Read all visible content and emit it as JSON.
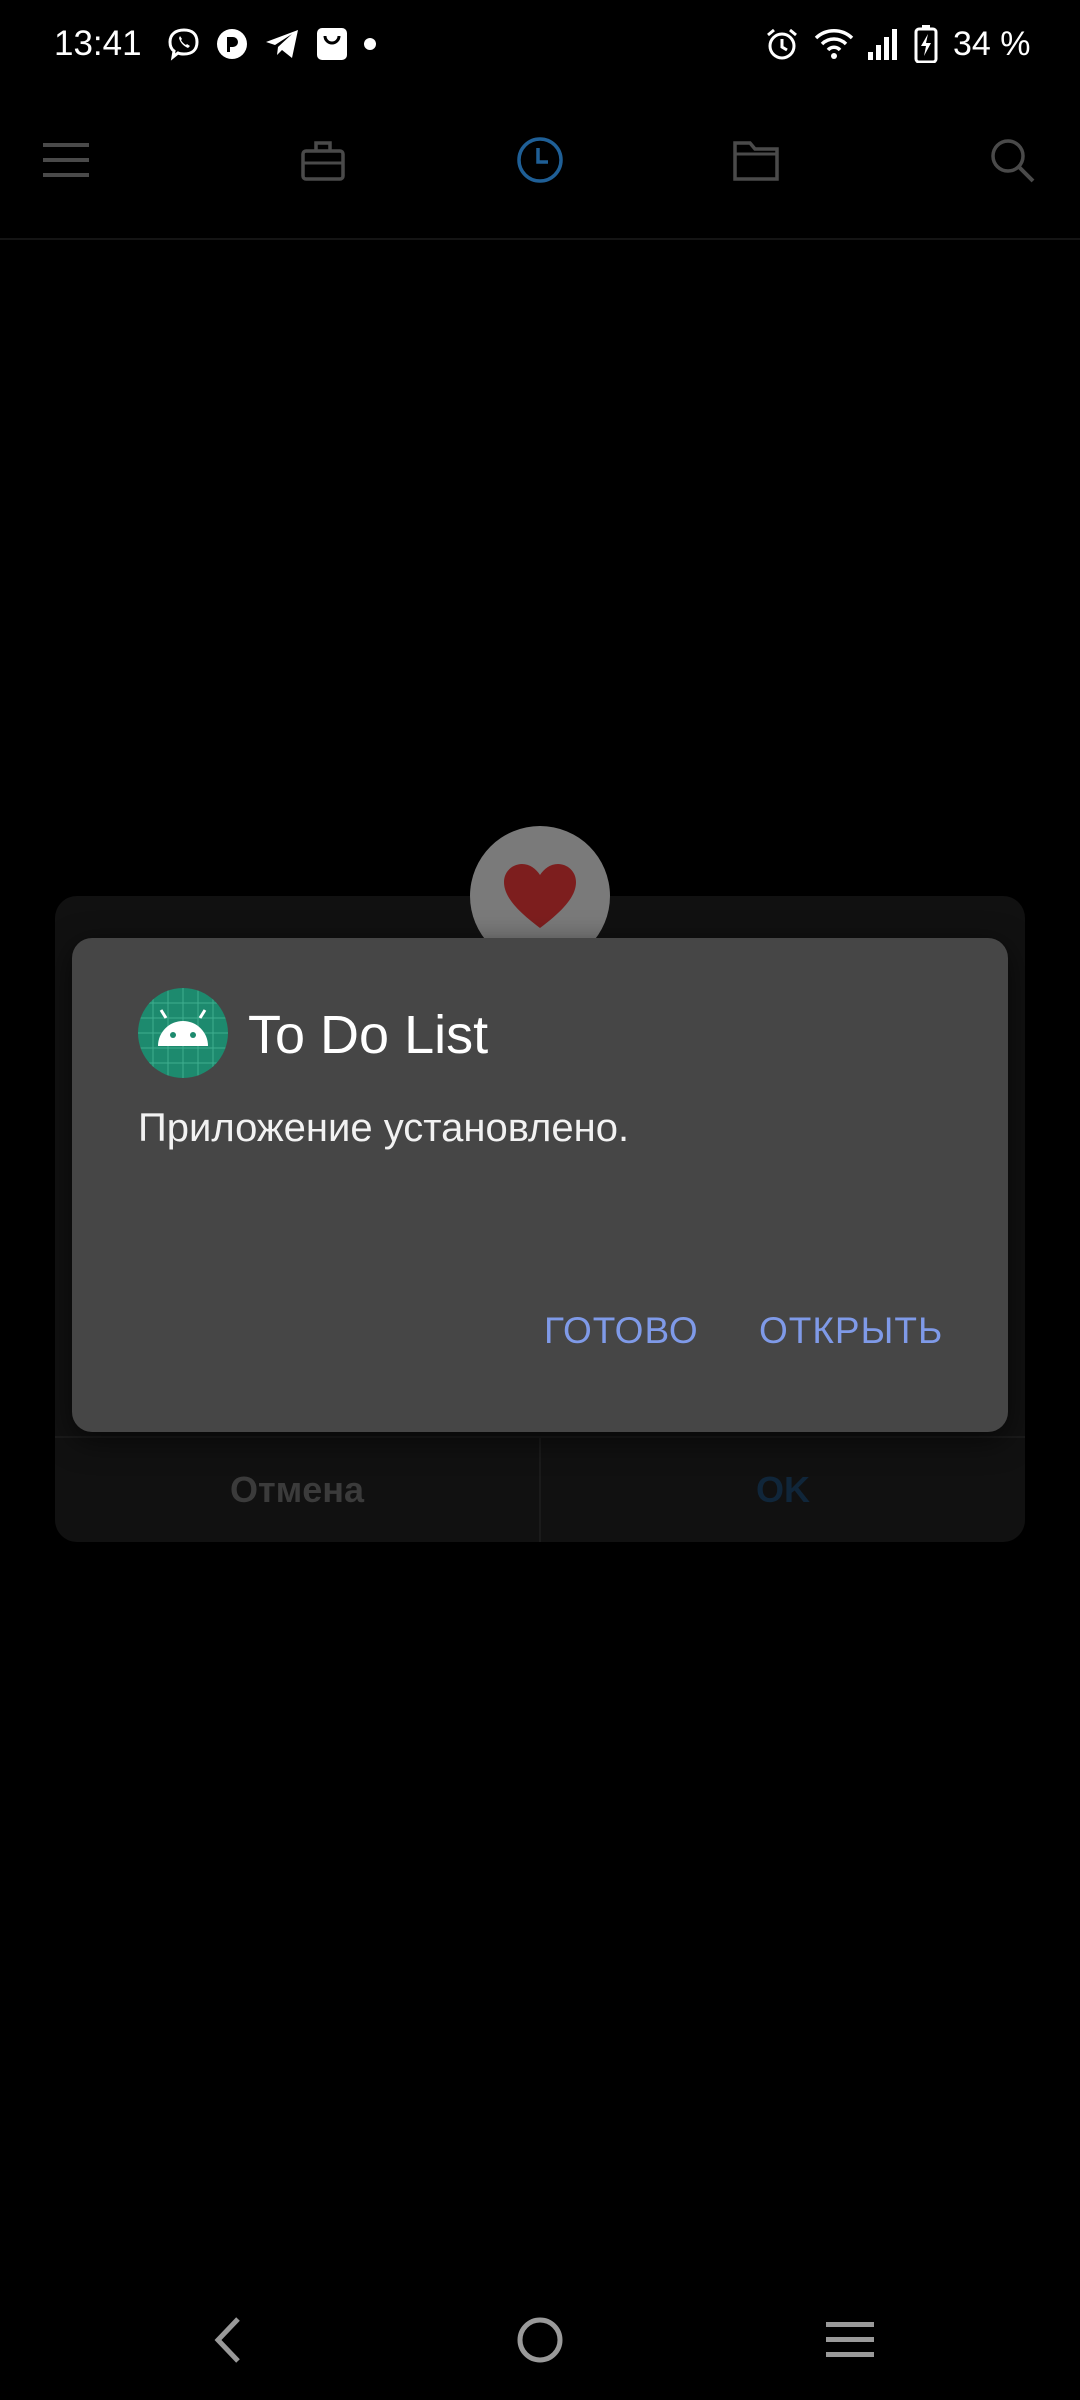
{
  "status_bar": {
    "time": "13:41",
    "battery_percent": "34 %",
    "notification_icons": [
      "viber-icon",
      "app-notification-icon",
      "telegram-icon",
      "shopping-bag-icon",
      "more-dot-icon"
    ],
    "system_icons": [
      "alarm-icon",
      "wifi-icon",
      "signal-icon",
      "battery-charging-icon"
    ]
  },
  "toolbar": {
    "icons": [
      "menu-icon",
      "briefcase-icon",
      "clock-icon",
      "folder-icon",
      "search-icon"
    ],
    "active_icon": "clock-icon",
    "active_color": "#1f5f96",
    "inactive_color": "#4a4a4a"
  },
  "background_dialog": {
    "cancel_label": "Отмена",
    "ok_label": "OK",
    "heart_color": "#7d1e1e"
  },
  "install_dialog": {
    "app_name": "To Do List",
    "message": "Приложение установлено.",
    "done_label": "ГОТОВО",
    "open_label": "ОТКРЫТЬ",
    "button_color": "#7f9ae8",
    "app_icon_color": "#1d8a6e"
  },
  "nav_bar": {
    "icons": [
      "back-icon",
      "home-icon",
      "recents-icon"
    ]
  }
}
